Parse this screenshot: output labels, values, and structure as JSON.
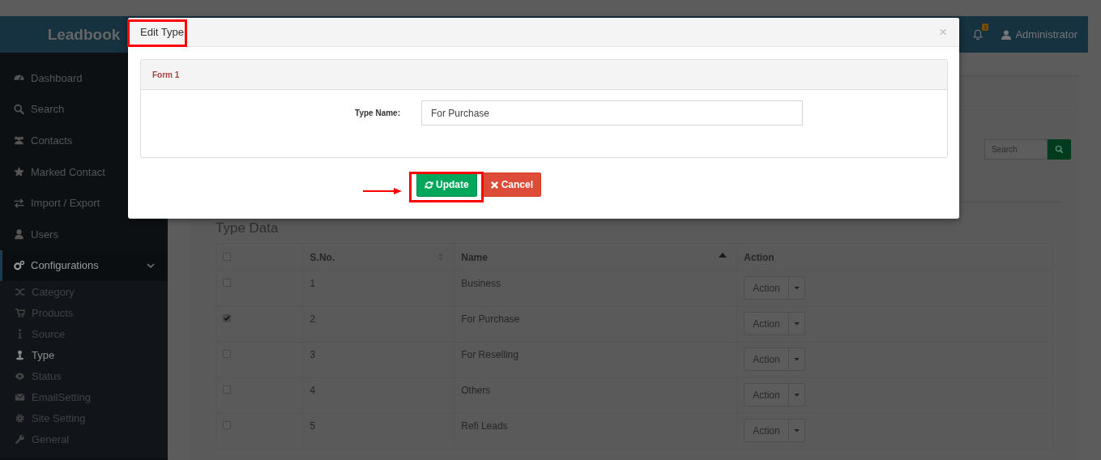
{
  "header": {
    "logo": "Leadbook",
    "notification_count": "1",
    "user": "Administrator"
  },
  "sidebar": {
    "items": [
      {
        "label": "Dashboard",
        "selected": false
      },
      {
        "label": "Search",
        "selected": false
      },
      {
        "label": "Contacts",
        "selected": false
      },
      {
        "label": "Marked Contact",
        "selected": false
      },
      {
        "label": "Import / Export",
        "selected": false
      },
      {
        "label": "Users",
        "selected": false
      },
      {
        "label": "Configurations",
        "selected": true,
        "expanded": true,
        "children": [
          {
            "label": "Category",
            "selected": false
          },
          {
            "label": "Products",
            "selected": false
          },
          {
            "label": "Source",
            "selected": false
          },
          {
            "label": "Type",
            "selected": true
          },
          {
            "label": "Status",
            "selected": false
          },
          {
            "label": "EmailSetting",
            "selected": false
          },
          {
            "label": "Site Setting",
            "selected": false
          },
          {
            "label": "General",
            "selected": false
          }
        ]
      }
    ]
  },
  "search": {
    "placeholder": "Search"
  },
  "section_title": "Type Data",
  "table": {
    "header_checked": false,
    "columns": [
      {
        "label": "S.No.",
        "sortable": true,
        "sorted": false
      },
      {
        "label": "Name",
        "sortable": true,
        "sorted": true
      },
      {
        "label": "Action",
        "sortable": false
      }
    ],
    "rows": [
      {
        "checked": false,
        "sno": "1",
        "name": "Business",
        "action": "Action"
      },
      {
        "checked": true,
        "sno": "2",
        "name": "For Purchase",
        "action": "Action"
      },
      {
        "checked": false,
        "sno": "3",
        "name": "For Reselling",
        "action": "Action"
      },
      {
        "checked": false,
        "sno": "4",
        "name": "Others",
        "action": "Action"
      },
      {
        "checked": false,
        "sno": "5",
        "name": "Refi Leads",
        "action": "Action"
      }
    ]
  },
  "modal": {
    "title": "Edit Type",
    "close": "×",
    "panel_title": "Form 1",
    "field": {
      "label": "Type Name:",
      "value": "For Purchase"
    },
    "buttons": [
      {
        "label": "Update",
        "kind": "update"
      },
      {
        "label": "Cancel",
        "kind": "cancel"
      }
    ]
  }
}
